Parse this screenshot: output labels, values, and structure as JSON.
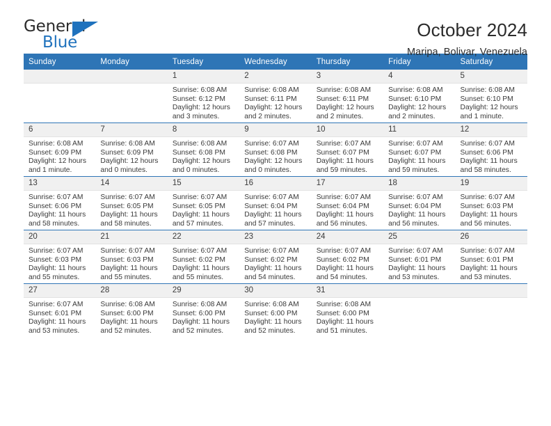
{
  "brand": {
    "name_top": "General",
    "name_bottom": "Blue",
    "accent_color": "#1f72bd"
  },
  "header": {
    "title": "October 2024",
    "subtitle": "Maripa, Bolivar, Venezuela"
  },
  "calendar": {
    "header_color": "#2e75b6",
    "daynum_background": "#f0f0f0",
    "weekdays": [
      "Sunday",
      "Monday",
      "Tuesday",
      "Wednesday",
      "Thursday",
      "Friday",
      "Saturday"
    ],
    "weeks": [
      [
        {
          "day": "",
          "lines": []
        },
        {
          "day": "",
          "lines": []
        },
        {
          "day": "1",
          "lines": [
            "Sunrise: 6:08 AM",
            "Sunset: 6:12 PM",
            "Daylight: 12 hours",
            "and 3 minutes."
          ]
        },
        {
          "day": "2",
          "lines": [
            "Sunrise: 6:08 AM",
            "Sunset: 6:11 PM",
            "Daylight: 12 hours",
            "and 2 minutes."
          ]
        },
        {
          "day": "3",
          "lines": [
            "Sunrise: 6:08 AM",
            "Sunset: 6:11 PM",
            "Daylight: 12 hours",
            "and 2 minutes."
          ]
        },
        {
          "day": "4",
          "lines": [
            "Sunrise: 6:08 AM",
            "Sunset: 6:10 PM",
            "Daylight: 12 hours",
            "and 2 minutes."
          ]
        },
        {
          "day": "5",
          "lines": [
            "Sunrise: 6:08 AM",
            "Sunset: 6:10 PM",
            "Daylight: 12 hours",
            "and 1 minute."
          ]
        }
      ],
      [
        {
          "day": "6",
          "lines": [
            "Sunrise: 6:08 AM",
            "Sunset: 6:09 PM",
            "Daylight: 12 hours",
            "and 1 minute."
          ]
        },
        {
          "day": "7",
          "lines": [
            "Sunrise: 6:08 AM",
            "Sunset: 6:09 PM",
            "Daylight: 12 hours",
            "and 0 minutes."
          ]
        },
        {
          "day": "8",
          "lines": [
            "Sunrise: 6:08 AM",
            "Sunset: 6:08 PM",
            "Daylight: 12 hours",
            "and 0 minutes."
          ]
        },
        {
          "day": "9",
          "lines": [
            "Sunrise: 6:07 AM",
            "Sunset: 6:08 PM",
            "Daylight: 12 hours",
            "and 0 minutes."
          ]
        },
        {
          "day": "10",
          "lines": [
            "Sunrise: 6:07 AM",
            "Sunset: 6:07 PM",
            "Daylight: 11 hours",
            "and 59 minutes."
          ]
        },
        {
          "day": "11",
          "lines": [
            "Sunrise: 6:07 AM",
            "Sunset: 6:07 PM",
            "Daylight: 11 hours",
            "and 59 minutes."
          ]
        },
        {
          "day": "12",
          "lines": [
            "Sunrise: 6:07 AM",
            "Sunset: 6:06 PM",
            "Daylight: 11 hours",
            "and 58 minutes."
          ]
        }
      ],
      [
        {
          "day": "13",
          "lines": [
            "Sunrise: 6:07 AM",
            "Sunset: 6:06 PM",
            "Daylight: 11 hours",
            "and 58 minutes."
          ]
        },
        {
          "day": "14",
          "lines": [
            "Sunrise: 6:07 AM",
            "Sunset: 6:05 PM",
            "Daylight: 11 hours",
            "and 58 minutes."
          ]
        },
        {
          "day": "15",
          "lines": [
            "Sunrise: 6:07 AM",
            "Sunset: 6:05 PM",
            "Daylight: 11 hours",
            "and 57 minutes."
          ]
        },
        {
          "day": "16",
          "lines": [
            "Sunrise: 6:07 AM",
            "Sunset: 6:04 PM",
            "Daylight: 11 hours",
            "and 57 minutes."
          ]
        },
        {
          "day": "17",
          "lines": [
            "Sunrise: 6:07 AM",
            "Sunset: 6:04 PM",
            "Daylight: 11 hours",
            "and 56 minutes."
          ]
        },
        {
          "day": "18",
          "lines": [
            "Sunrise: 6:07 AM",
            "Sunset: 6:04 PM",
            "Daylight: 11 hours",
            "and 56 minutes."
          ]
        },
        {
          "day": "19",
          "lines": [
            "Sunrise: 6:07 AM",
            "Sunset: 6:03 PM",
            "Daylight: 11 hours",
            "and 56 minutes."
          ]
        }
      ],
      [
        {
          "day": "20",
          "lines": [
            "Sunrise: 6:07 AM",
            "Sunset: 6:03 PM",
            "Daylight: 11 hours",
            "and 55 minutes."
          ]
        },
        {
          "day": "21",
          "lines": [
            "Sunrise: 6:07 AM",
            "Sunset: 6:03 PM",
            "Daylight: 11 hours",
            "and 55 minutes."
          ]
        },
        {
          "day": "22",
          "lines": [
            "Sunrise: 6:07 AM",
            "Sunset: 6:02 PM",
            "Daylight: 11 hours",
            "and 55 minutes."
          ]
        },
        {
          "day": "23",
          "lines": [
            "Sunrise: 6:07 AM",
            "Sunset: 6:02 PM",
            "Daylight: 11 hours",
            "and 54 minutes."
          ]
        },
        {
          "day": "24",
          "lines": [
            "Sunrise: 6:07 AM",
            "Sunset: 6:02 PM",
            "Daylight: 11 hours",
            "and 54 minutes."
          ]
        },
        {
          "day": "25",
          "lines": [
            "Sunrise: 6:07 AM",
            "Sunset: 6:01 PM",
            "Daylight: 11 hours",
            "and 53 minutes."
          ]
        },
        {
          "day": "26",
          "lines": [
            "Sunrise: 6:07 AM",
            "Sunset: 6:01 PM",
            "Daylight: 11 hours",
            "and 53 minutes."
          ]
        }
      ],
      [
        {
          "day": "27",
          "lines": [
            "Sunrise: 6:07 AM",
            "Sunset: 6:01 PM",
            "Daylight: 11 hours",
            "and 53 minutes."
          ]
        },
        {
          "day": "28",
          "lines": [
            "Sunrise: 6:08 AM",
            "Sunset: 6:00 PM",
            "Daylight: 11 hours",
            "and 52 minutes."
          ]
        },
        {
          "day": "29",
          "lines": [
            "Sunrise: 6:08 AM",
            "Sunset: 6:00 PM",
            "Daylight: 11 hours",
            "and 52 minutes."
          ]
        },
        {
          "day": "30",
          "lines": [
            "Sunrise: 6:08 AM",
            "Sunset: 6:00 PM",
            "Daylight: 11 hours",
            "and 52 minutes."
          ]
        },
        {
          "day": "31",
          "lines": [
            "Sunrise: 6:08 AM",
            "Sunset: 6:00 PM",
            "Daylight: 11 hours",
            "and 51 minutes."
          ]
        },
        {
          "day": "",
          "lines": []
        },
        {
          "day": "",
          "lines": []
        }
      ]
    ]
  }
}
